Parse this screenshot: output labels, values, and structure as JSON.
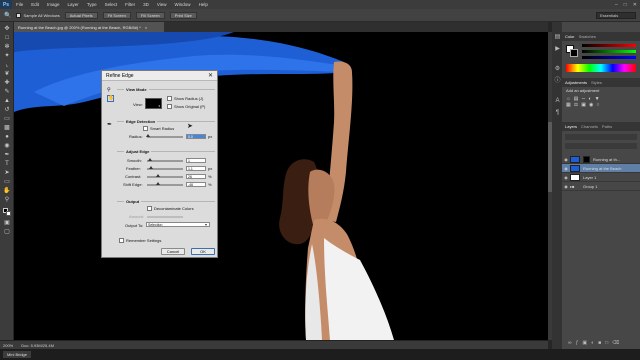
{
  "app": {
    "logo": "Ps"
  },
  "menu": [
    "File",
    "Edit",
    "Image",
    "Layer",
    "Type",
    "Select",
    "Filter",
    "3D",
    "View",
    "Window",
    "Help"
  ],
  "window_controls": {
    "minimize": "–",
    "maximize": "□",
    "close": "✕"
  },
  "options_bar": {
    "sample_all_windows": "Sample All Windows",
    "buttons": [
      "Actual Pixels",
      "Fit Screen",
      "Fill Screen",
      "Print Size"
    ],
    "workspace": "Essentials"
  },
  "document": {
    "tab_title": "Running at the Beach.jpg @ 200% (Running at the Beach, RGB/8#) *",
    "close": "×"
  },
  "status_bar": {
    "zoom": "200%",
    "doc_info": "Doc: 5.93M/25.4M"
  },
  "bottom_tabs": {
    "mini_bridge": "Mini Bridge"
  },
  "panels": {
    "color_tabs": [
      "Color",
      "Swatches"
    ],
    "adjustments_tabs": [
      "Adjustments",
      "Styles"
    ],
    "adjustments_hint": "Add an adjustment",
    "layers_tabs": [
      "Layers",
      "Channels",
      "Paths"
    ],
    "layers": [
      {
        "name": "Running at th...",
        "selected": false
      },
      {
        "name": "Running at the Beach",
        "selected": true
      },
      {
        "name": "Layer 1",
        "selected": false
      },
      {
        "name": "Group 1",
        "selected": false
      }
    ]
  },
  "dialog": {
    "title": "Refine Edge",
    "close": "✕",
    "view_mode": {
      "heading": "View Mode",
      "view_label": "View:",
      "show_radius": "Show Radius (J)",
      "show_original": "Show Original (P)"
    },
    "edge_detection": {
      "heading": "Edge Detection",
      "smart_radius": "Smart Radius",
      "radius_label": "Radius:",
      "radius_value": "0.0",
      "radius_unit": "px"
    },
    "adjust_edge": {
      "heading": "Adjust Edge",
      "smooth_label": "Smooth:",
      "smooth_value": "1",
      "feather_label": "Feather:",
      "feather_value": "1.1",
      "feather_unit": "px",
      "contrast_label": "Contrast:",
      "contrast_value": "26",
      "contrast_unit": "%",
      "shift_label": "Shift Edge:",
      "shift_value": "-46",
      "shift_unit": "%"
    },
    "output": {
      "heading": "Output",
      "decontaminate": "Decontaminate Colors",
      "amount_label": "Amount:",
      "output_to_label": "Output To:",
      "output_to_value": "Selection"
    },
    "remember": "Remember Settings",
    "cancel": "Cancel",
    "ok": "OK"
  },
  "colors": {
    "accent": "#5f7fa6",
    "fabric": "#1e5fd6"
  }
}
